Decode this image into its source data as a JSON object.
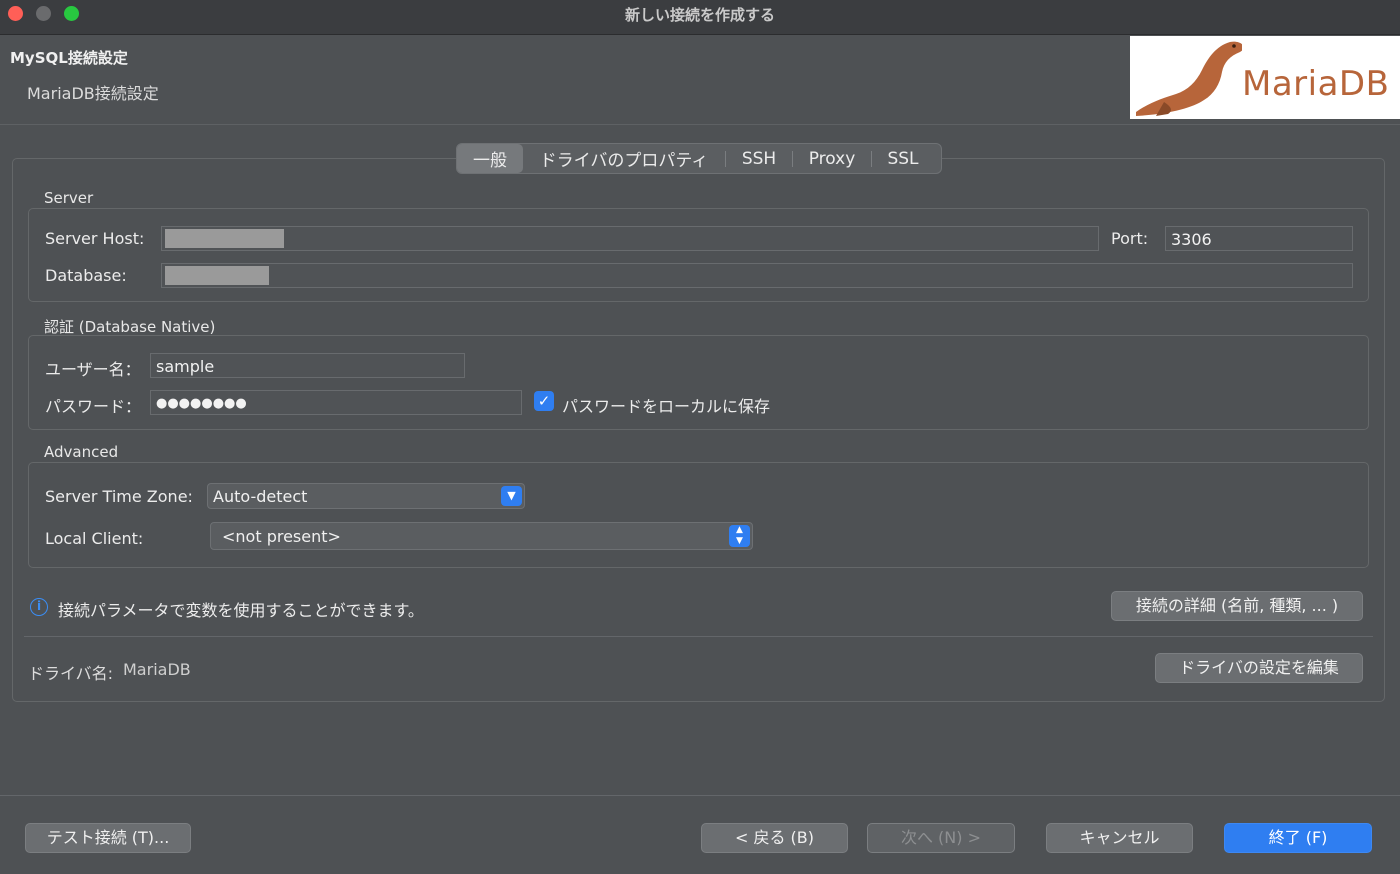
{
  "window": {
    "title": "新しい接続を作成する"
  },
  "header": {
    "title": "MySQL接続設定",
    "subtitle": "MariaDB接続設定",
    "logo_text": "MariaDB"
  },
  "tabs": [
    "一般",
    "ドライバのプロパティ",
    "SSH",
    "Proxy",
    "SSL"
  ],
  "server": {
    "section": "Server",
    "host_label": "Server Host:",
    "host_value": "",
    "port_label": "Port:",
    "port_value": "3306",
    "database_label": "Database:",
    "database_value": ""
  },
  "auth": {
    "section": "認証 (Database Native)",
    "user_label": "ユーザー名：",
    "user_value": "sample",
    "password_label": "パスワード：",
    "password_value": "●●●●●●●●",
    "save_password_label": "パスワードをローカルに保存",
    "save_password_checked": true
  },
  "advanced": {
    "section": "Advanced",
    "timezone_label": "Server Time Zone:",
    "timezone_value": "Auto-detect",
    "local_client_label": "Local Client:",
    "local_client_value": "<not present>"
  },
  "info_text": "接続パラメータで変数を使用することができます。",
  "details_button": "接続の詳細 (名前, 種類, ... )",
  "driver": {
    "label": "ドライバ名:",
    "value": "MariaDB",
    "edit_button": "ドライバの設定を編集"
  },
  "footer": {
    "test_button": "テスト接続 (T)...",
    "back_button": "< 戻る (B)",
    "next_button": "次へ (N) >",
    "cancel_button": "キャンセル",
    "finish_button": "終了 (F)"
  },
  "colors": {
    "accent": "#2f7ef1",
    "background": "#4e5154"
  }
}
